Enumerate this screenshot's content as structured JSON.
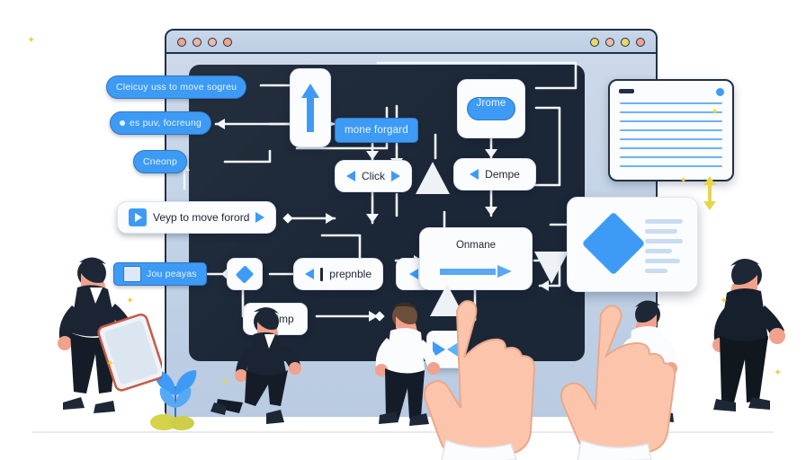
{
  "scene": {
    "title": "Browser flowchart illustration with walking figures and pointing hands",
    "background_color": "#ffffff"
  },
  "browser_window": {
    "name": "browser-window",
    "titlebar": {
      "left_dots": [
        {
          "name": "window-dot-1",
          "color": "#f0a28c"
        },
        {
          "name": "window-dot-2",
          "color": "#f2b0a0"
        },
        {
          "name": "window-dot-3",
          "color": "#f3b7a8"
        },
        {
          "name": "window-dot-4",
          "color": "#f0a28c"
        }
      ],
      "right_dots": [
        {
          "name": "window-dot-5",
          "color": "#ead86a"
        },
        {
          "name": "window-dot-6",
          "color": "#f3b7a8"
        },
        {
          "name": "window-dot-7",
          "color": "#ead86a"
        },
        {
          "name": "window-dot-8",
          "color": "#f0a28c"
        }
      ]
    }
  },
  "flowchart": {
    "panel_color": "#1b2636",
    "nodes": [
      {
        "id": "n1",
        "name": "node-cleicuy-move-sogreu",
        "label": "Cleicuy uss to move sogreu",
        "style": "pill"
      },
      {
        "id": "n2",
        "name": "node-es-puv-focreung",
        "label": "es puv, focreung",
        "style": "pill"
      },
      {
        "id": "n3",
        "name": "node-cneonp",
        "label": "Cneonp",
        "style": "pill"
      },
      {
        "id": "n4",
        "name": "node-veyp-to-move-forord",
        "label": "Veyp to move forord",
        "style": "card"
      },
      {
        "id": "n5",
        "name": "node-jou-peayas",
        "label": "Jou peayas",
        "style": "pill"
      },
      {
        "id": "n6",
        "name": "node-ugoimp",
        "label": "Ugoimp",
        "style": "card"
      },
      {
        "id": "n7",
        "name": "node-mone-forgard",
        "label": "mone forgard",
        "style": "pill"
      },
      {
        "id": "n8",
        "name": "node-click",
        "label": "Click",
        "style": "card"
      },
      {
        "id": "n9",
        "name": "node-prepnble",
        "label": "prepnble",
        "style": "card"
      },
      {
        "id": "n10",
        "name": "node-jrome",
        "label": "Jrome",
        "style": "pill-in-card"
      },
      {
        "id": "n11",
        "name": "node-dempe",
        "label": "Dempe",
        "style": "card"
      },
      {
        "id": "n12",
        "name": "node-onmane",
        "label": "Onmane",
        "style": "big-card"
      }
    ],
    "icon_nodes": [
      {
        "name": "node-up-arrow-card",
        "icon": "arrow-up-icon"
      },
      {
        "name": "node-diamond-card",
        "icon": "diamond-icon"
      },
      {
        "name": "node-left-arrow-card",
        "icon": "arrow-left-icon"
      },
      {
        "name": "node-bowtie-card",
        "icon": "bowtie-icon"
      },
      {
        "name": "node-triangle",
        "icon": "triangle-up-icon"
      }
    ],
    "accent_color": "#3d9bf5",
    "wire_color": "#f2f6fa"
  },
  "doc_card": {
    "name": "document-card",
    "line_count": 8,
    "line_color": "#6fb2f2",
    "dot_color": "#3d9bf5"
  },
  "diamond_card": {
    "name": "diamond-detail-card",
    "diamond_color": "#3d9bf5",
    "line_count": 6
  },
  "people": [
    {
      "name": "person-carrying-tablet",
      "outfit": "dark-suit",
      "pose": "walking-left"
    },
    {
      "name": "person-running",
      "outfit": "dark-suit",
      "pose": "running-left"
    },
    {
      "name": "person-white-shirt-left",
      "outfit": "white-shirt",
      "pose": "walking-left"
    },
    {
      "name": "person-white-shirt-right",
      "outfit": "white-shirt",
      "pose": "walking-right"
    },
    {
      "name": "person-dark-outfit-right",
      "outfit": "dark-outfit",
      "pose": "walking-right"
    }
  ],
  "hands": [
    {
      "name": "pointing-hand-left",
      "gesture": "index-finger-point"
    },
    {
      "name": "pointing-hand-right",
      "gesture": "index-finger-point"
    }
  ],
  "decor": {
    "plant": {
      "name": "plant-decoration",
      "leaf_color": "#3d9bf5",
      "bush_color": "#d4d34a"
    },
    "yellow_arrow": {
      "name": "vertical-double-arrow-icon",
      "color": "#e8d44d"
    }
  }
}
